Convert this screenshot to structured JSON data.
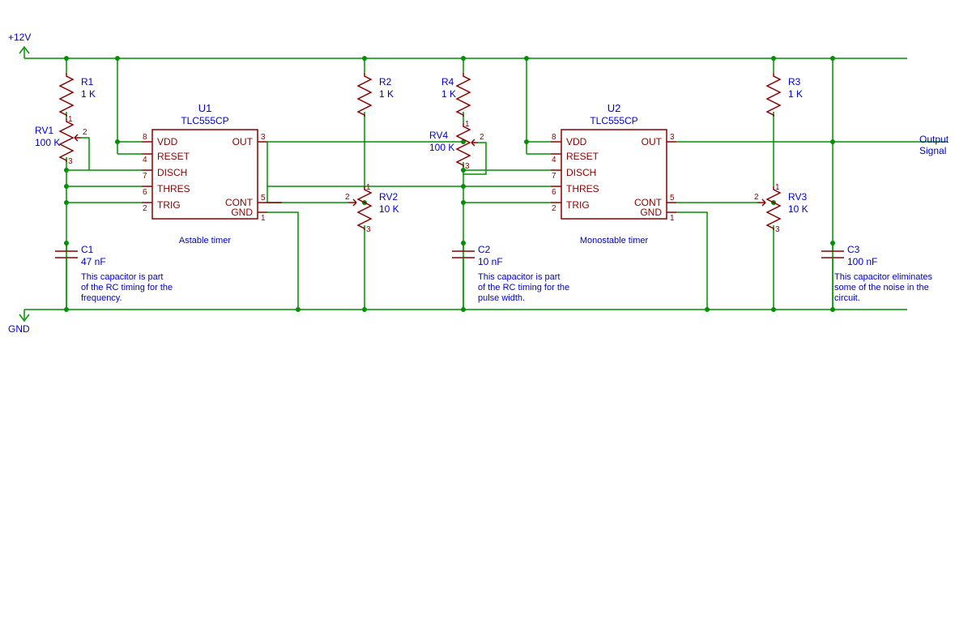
{
  "power": {
    "pos": "+12V",
    "neg": "GND"
  },
  "output": {
    "l1": "Output",
    "l2": "Signal"
  },
  "ic": {
    "u1": {
      "ref": "U1",
      "val": "TLC555CP",
      "note": "Astable timer",
      "pins": {
        "vdd": "VDD",
        "reset": "RESET",
        "disch": "DISCH",
        "thres": "THRES",
        "trig": "TRIG",
        "out": "OUT",
        "cont": "CONT",
        "gnd": "GND",
        "n8": "8",
        "n4": "4",
        "n7": "7",
        "n6": "6",
        "n2": "2",
        "n3": "3",
        "n5": "5",
        "n1": "1"
      }
    },
    "u2": {
      "ref": "U2",
      "val": "TLC555CP",
      "note": "Monostable timer",
      "pins": {
        "vdd": "VDD",
        "reset": "RESET",
        "disch": "DISCH",
        "thres": "THRES",
        "trig": "TRIG",
        "out": "OUT",
        "cont": "CONT",
        "gnd": "GND",
        "n8": "8",
        "n4": "4",
        "n7": "7",
        "n6": "6",
        "n2": "2",
        "n3": "3",
        "n5": "5",
        "n1": "1"
      }
    }
  },
  "r": {
    "r1": {
      "ref": "R1",
      "val": "1 K"
    },
    "r2": {
      "ref": "R2",
      "val": "1 K"
    },
    "r3": {
      "ref": "R3",
      "val": "1 K"
    },
    "r4": {
      "ref": "R4",
      "val": "1 K"
    }
  },
  "rv": {
    "rv1": {
      "ref": "RV1",
      "val": "100 K",
      "t1": "1",
      "t2": "2",
      "t3": "3"
    },
    "rv2": {
      "ref": "RV2",
      "val": "10 K",
      "t1": "1",
      "t2": "2",
      "t3": "3"
    },
    "rv3": {
      "ref": "RV3",
      "val": "10 K",
      "t1": "1",
      "t2": "2",
      "t3": "3"
    },
    "rv4": {
      "ref": "RV4",
      "val": "100 K",
      "t1": "1",
      "t2": "2",
      "t3": "3"
    }
  },
  "c": {
    "c1": {
      "ref": "C1",
      "val": "47 nF",
      "note": "This capacitor is part\nof the RC timing for the\nfrequency."
    },
    "c2": {
      "ref": "C2",
      "val": "10 nF",
      "note": "This capacitor is part\nof the RC timing for the\npulse width."
    },
    "c3": {
      "ref": "C3",
      "val": "100 nF",
      "note": "This capacitor eliminates\nsome of the noise in the\ncircuit."
    }
  }
}
